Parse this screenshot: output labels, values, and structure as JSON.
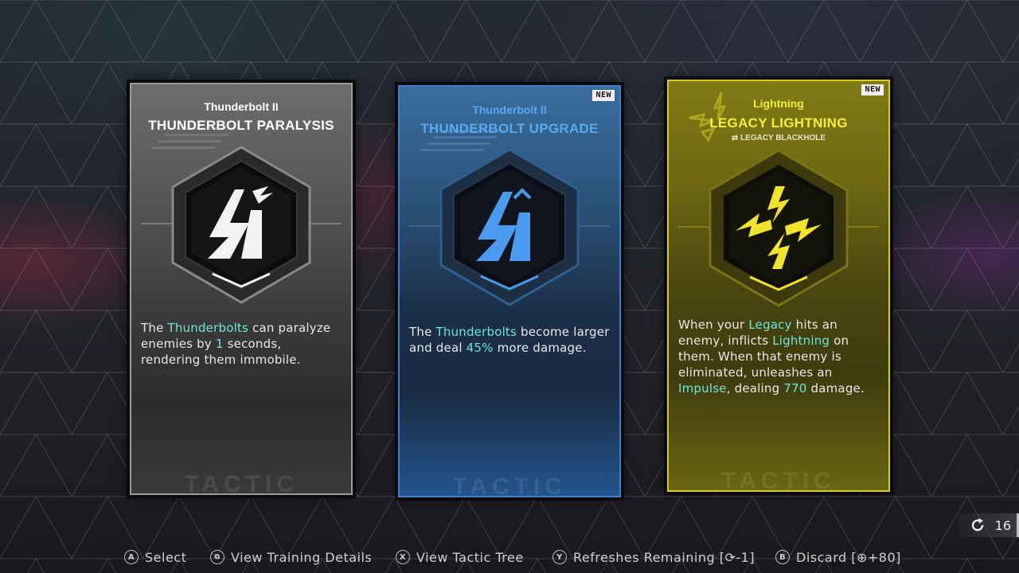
{
  "cards": [
    {
      "subtitle": "Thunderbolt II",
      "title": "THUNDERBOLT PARALYSIS",
      "badge": "",
      "desc_parts": [
        {
          "t": "The ",
          "h": false
        },
        {
          "t": "Thunderbolts",
          "h": true
        },
        {
          "t": " can paralyze enemies by ",
          "h": false
        },
        {
          "t": "1",
          "h": true
        },
        {
          "t": " seconds, rendering them immobile.",
          "h": false
        }
      ],
      "watermark": "TACTIC",
      "icon": "thunderbolt-icon",
      "accent": "#ffffff"
    },
    {
      "subtitle": "Thunderbolt II",
      "title": "THUNDERBOLT UPGRADE",
      "badge": "NEW",
      "desc_parts": [
        {
          "t": "The ",
          "h": false
        },
        {
          "t": "Thunderbolts",
          "h": true
        },
        {
          "t": " become larger and deal ",
          "h": false
        },
        {
          "t": "45%",
          "h": true
        },
        {
          "t": " more damage.",
          "h": false
        }
      ],
      "watermark": "TACTIC",
      "icon": "thunderbolt-upgrade-icon",
      "accent": "#4a9af0"
    },
    {
      "subtitle": "Lightning",
      "title": "LEGACY LIGHTNING",
      "swap": "⇄ LEGACY BLACKHOLE",
      "badge": "NEW",
      "desc_parts": [
        {
          "t": "When your ",
          "h": false
        },
        {
          "t": "Legacy",
          "h": true
        },
        {
          "t": " hits an enemy, inflicts ",
          "h": false
        },
        {
          "t": "Lightning",
          "h": true
        },
        {
          "t": " on them. When that enemy is eliminated, unleashes an ",
          "h": false
        },
        {
          "t": "Impulse",
          "h": true
        },
        {
          "t": ", dealing ",
          "h": false
        },
        {
          "t": "770",
          "h": true
        },
        {
          "t": " damage.",
          "h": false
        }
      ],
      "watermark": "TACTIC",
      "icon": "lightning-burst-icon",
      "accent": "#f2e42a"
    }
  ],
  "refresh": {
    "count": "16",
    "icon": "refresh-icon"
  },
  "footer": {
    "select": {
      "glyph": "A",
      "label": "Select"
    },
    "training": {
      "glyph": "⧉",
      "label": "View Training Details"
    },
    "tree": {
      "glyph": "X",
      "label": "View Tactic Tree"
    },
    "refreshes": {
      "glyph": "Y",
      "label": "Refreshes Remaining [⟳-1]"
    },
    "discard": {
      "glyph": "B",
      "label": "Discard [⊕+80]"
    }
  },
  "colors": {
    "highlight": "#6ee6d8",
    "gray_title": "#ffffff",
    "blue_title": "#5aa8ee",
    "gold_title": "#f5ee3a"
  }
}
